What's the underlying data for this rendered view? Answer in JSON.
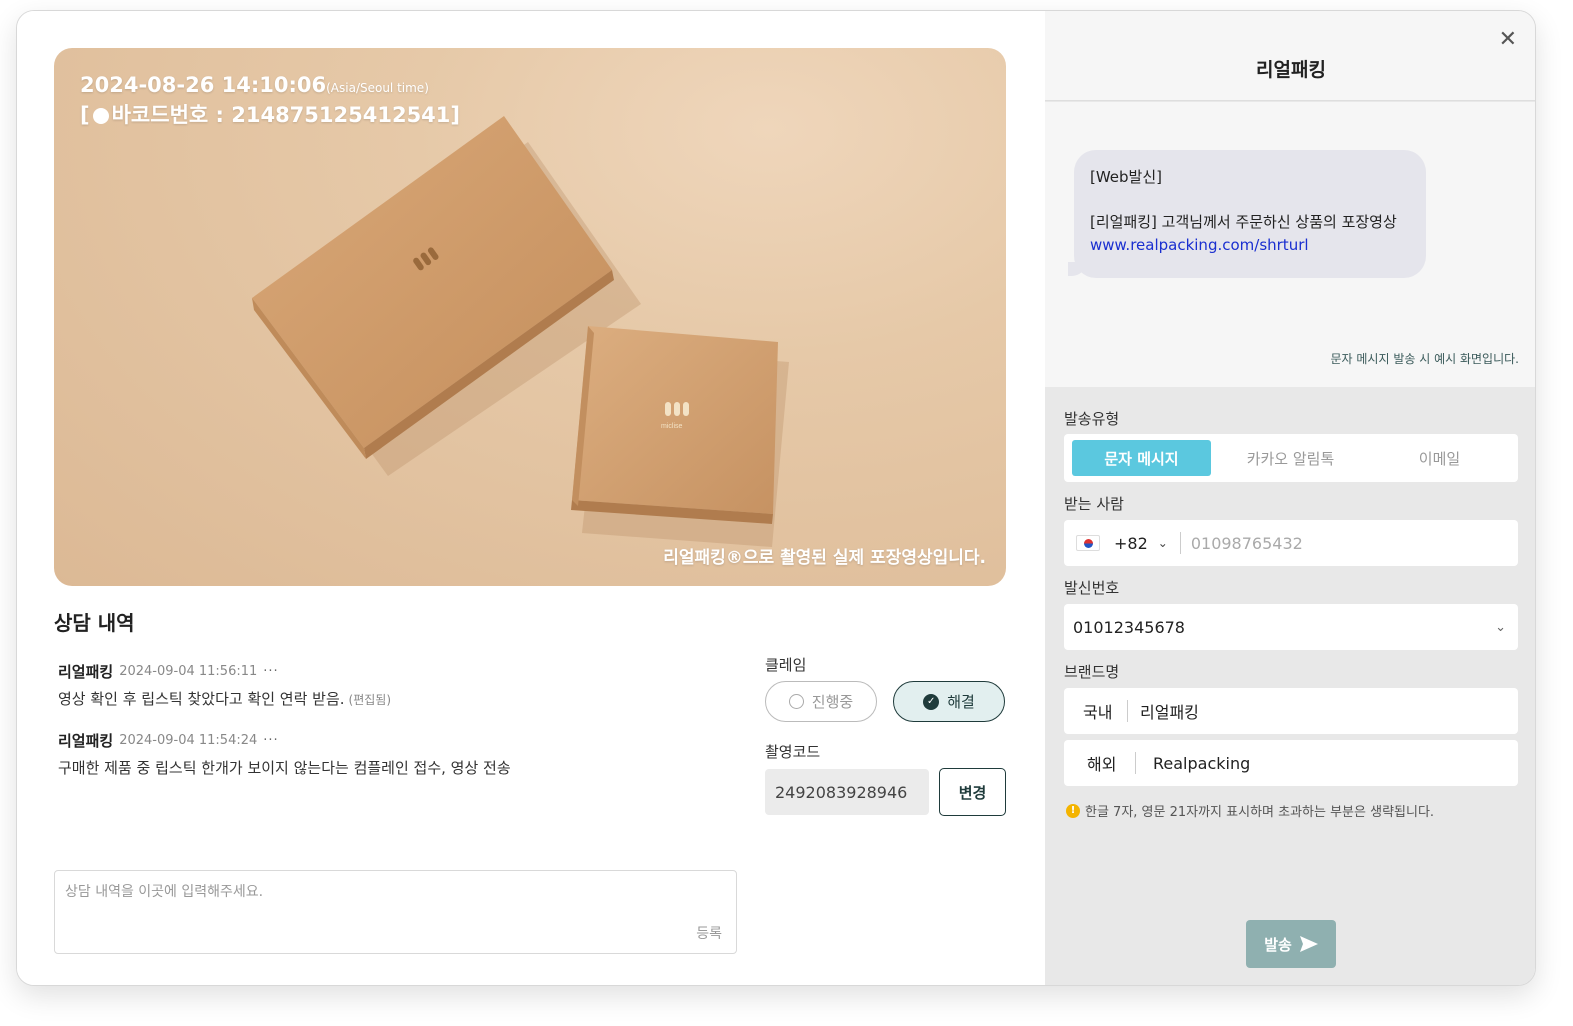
{
  "photo": {
    "timestamp": "2024-08-26 14:10:06",
    "timezone": "(Asia/Seoul time)",
    "barcode_prefix": "[",
    "barcode_text": "바코드번호 : 214875125412541]",
    "caption": "리얼패킹®으로 촬영된 실제 포장영상입니다.",
    "box_logo": "miclise"
  },
  "counsel": {
    "title": "상담 내역",
    "entries": [
      {
        "author": "리얼패킹",
        "time": "2024-09-04 11:56:11",
        "more": "···",
        "text": "영상 확인 후 립스틱 찾았다고 확인 연락 받음.",
        "edited": "(편집됨)"
      },
      {
        "author": "리얼패킹",
        "time": "2024-09-04 11:54:24",
        "more": "···",
        "text": "구매한 제품 중 립스틱 한개가 보이지 않는다는 컴플레인 접수, 영상 전송"
      }
    ],
    "input_placeholder": "상담 내역을 이곳에 입력해주세요.",
    "register_label": "등록"
  },
  "claim": {
    "label": "클레임",
    "in_progress": "진행중",
    "resolved": "해결",
    "selected": "해결"
  },
  "code": {
    "label": "촬영코드",
    "value": "2492083928946",
    "change_label": "변경"
  },
  "panel": {
    "title": "리얼패킹",
    "close": "✕",
    "preview": {
      "line1": "[Web발신]",
      "line2": "[리얼패킹] 고객님께서 주문하신 상품의 포장영상",
      "link": "www.realpacking.com/shrturl",
      "note": "문자 메시지 발송 시 예시 화면입니다."
    },
    "send_type_label": "발송유형",
    "tabs": [
      "문자 메시지",
      "카카오 알림톡",
      "이메일"
    ],
    "active_tab": "문자 메시지",
    "recipient_label": "받는 사람",
    "country_code": "+82",
    "phone_placeholder": "01098765432",
    "sender_label": "발신번호",
    "sender_value": "01012345678",
    "brand_label": "브랜드명",
    "brand_domestic_label": "국내",
    "brand_domestic_value": "리얼패킹",
    "brand_overseas_label": "해외",
    "brand_overseas_value": "Realpacking",
    "brand_note": "한글 7자, 영문 21자까지 표시하며 초과하는 부분은 생략됩니다.",
    "send_label": "발송"
  },
  "colors": {
    "accent": "#5bc8df",
    "primary_dark": "#1f3b3b",
    "send_button": "#8fb0b0",
    "link": "#1a2fd0"
  }
}
